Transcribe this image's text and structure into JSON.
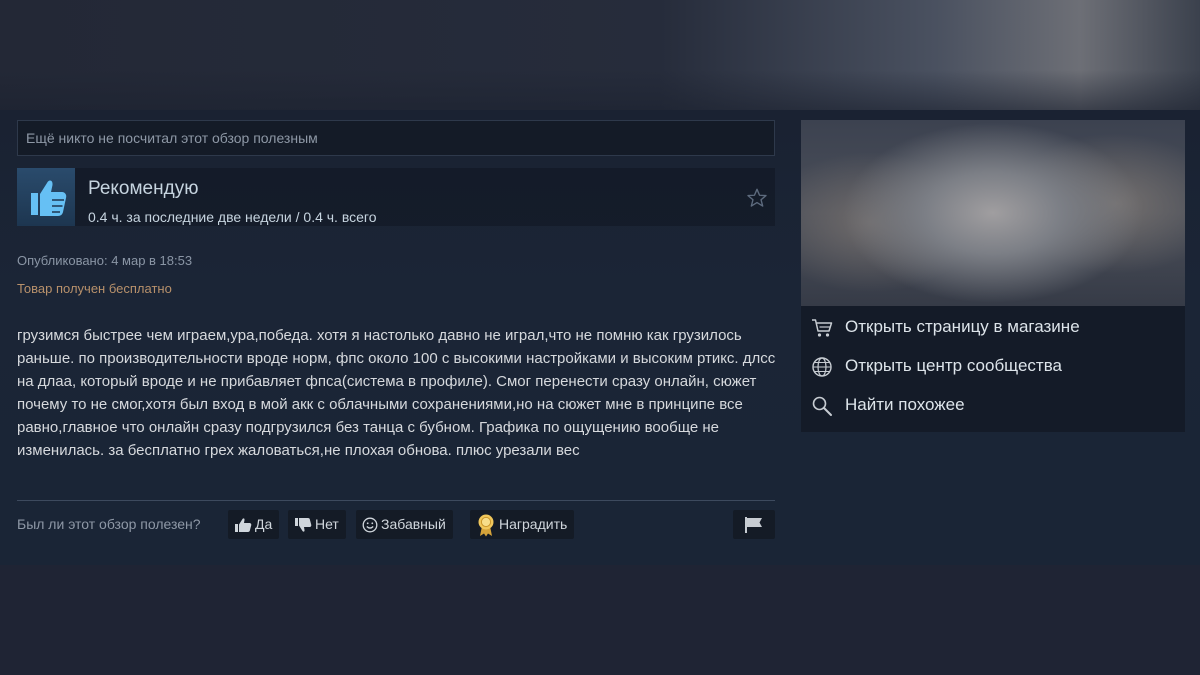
{
  "helpful_status": "Ещё никто не посчитал этот обзор полезным",
  "review": {
    "verdict": "Рекомендую",
    "hours": "0.4 ч. за последние две недели / 0.4 ч. всего",
    "posted": "Опубликовано: 4 мар в 18:53",
    "free_note": "Товар получен бесплатно",
    "text": "грузимся быстрее чем играем,ура,победа. хотя я настолько давно не играл,что не помню как грузилось раньше. по производительности вроде норм, фпс около 100 с высокими настройками и высоким ртикс. длсс на длаа, который вроде и не прибавляет фпса(система в профиле). Смог перенести сразу онлайн, сюжет почему то не смог,хотя был вход в мой акк с облачными сохранениями,но на сюжет мне в принципе все равно,главное что онлайн сразу подгрузился без танца с бубном. Графика по ощущению вообще не изменилась. за бесплатно грех жаловаться,не плохая обнова. плюс урезали вес"
  },
  "vote": {
    "question": "Был ли этот обзор полезен?",
    "yes_label": "Да",
    "no_label": "Нет",
    "funny_label": "Забавный",
    "award_label": "Наградить"
  },
  "sidebar": {
    "links": [
      {
        "label": "Открыть страницу в магазине",
        "icon": "cart-icon"
      },
      {
        "label": "Открыть центр сообщества",
        "icon": "globe-icon"
      },
      {
        "label": "Найти похожее",
        "icon": "search-icon"
      }
    ]
  },
  "colors": {
    "background": "#1f2535",
    "text_primary": "#c6d4df",
    "text_muted": "#8e98a6",
    "free_note": "#b8916b",
    "thumb_blue": "#66c0f4"
  }
}
